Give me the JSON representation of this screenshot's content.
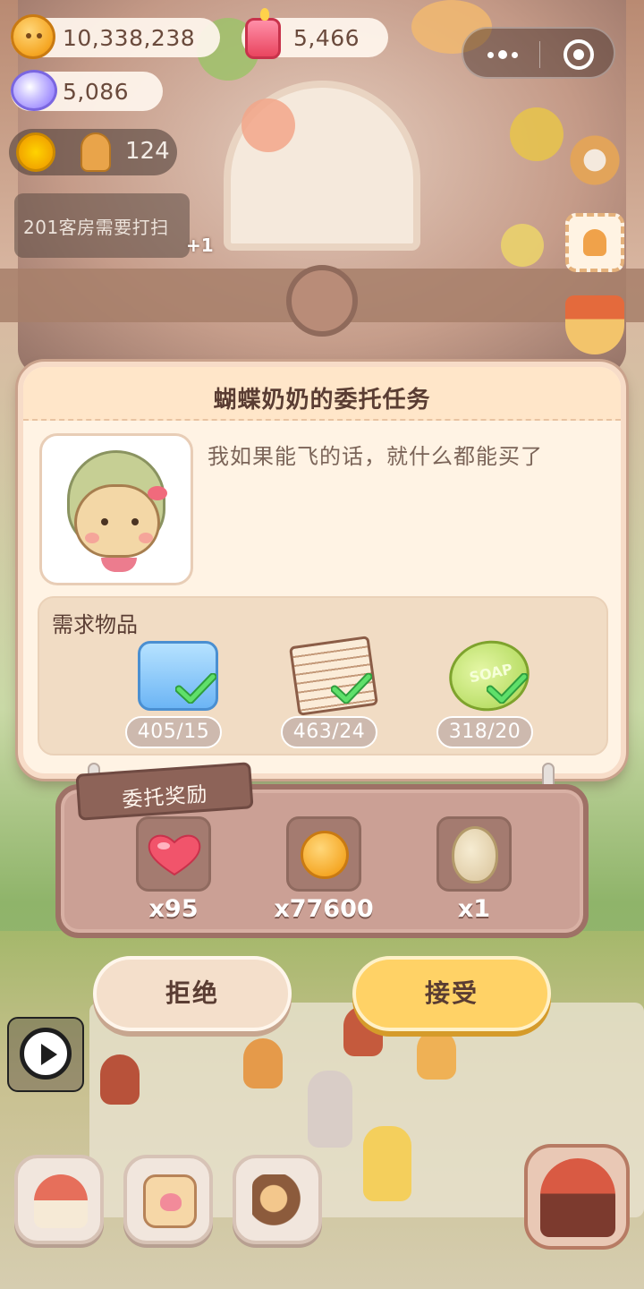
{
  "hud": {
    "cookies": "10,338,238",
    "candles": "5,466",
    "gems": "5,086",
    "sun_count": "124",
    "task_tip": "201客房需要打扫",
    "plus_one": "+1"
  },
  "dialog": {
    "title": "蝴蝶奶奶的委托任务",
    "quote": "我如果能飞的话，就什么都能买了",
    "need_title": "需求物品",
    "needs": [
      {
        "icon": "detergent-icon",
        "count": "405/15"
      },
      {
        "icon": "newspaper-icon",
        "count": "463/24"
      },
      {
        "icon": "soap-icon",
        "count": "318/20",
        "art_text": "SOAP"
      }
    ]
  },
  "rewards": {
    "title": "委托奖励",
    "items": [
      {
        "icon": "heart-icon",
        "qty": "x95"
      },
      {
        "icon": "cookie-coin-icon",
        "qty": "x77600"
      },
      {
        "icon": "egg-icon",
        "qty": "x1"
      }
    ]
  },
  "buttons": {
    "reject": "拒绝",
    "accept": "接受"
  },
  "colors": {
    "accept": "#ffd266",
    "reject": "#f4dfcb",
    "check": "#3fce4f",
    "board": "#cba095"
  }
}
